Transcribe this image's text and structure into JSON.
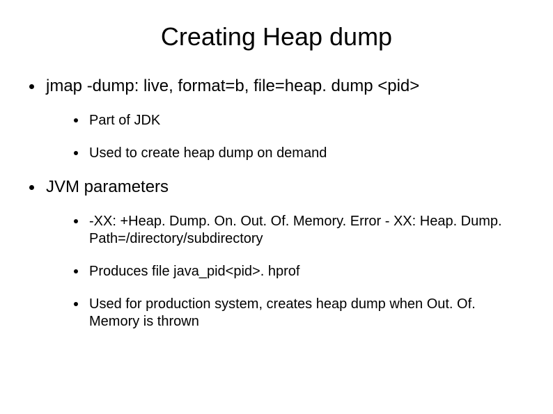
{
  "title": "Creating Heap dump",
  "bullets": [
    {
      "text": "jmap -dump: live, format=b, file=heap. dump <pid>",
      "children": [
        {
          "text": "Part of JDK"
        },
        {
          "text": "Used to create heap dump on demand"
        }
      ]
    },
    {
      "text": "JVM parameters",
      "children": [
        {
          "text": "-XX: +Heap. Dump. On. Out. Of. Memory. Error - XX: Heap. Dump. Path=/directory/subdirectory"
        },
        {
          "text": "Produces file java_pid<pid>. hprof"
        },
        {
          "text": "Used for production system, creates heap dump when Out. Of. Memory is thrown"
        }
      ]
    }
  ]
}
